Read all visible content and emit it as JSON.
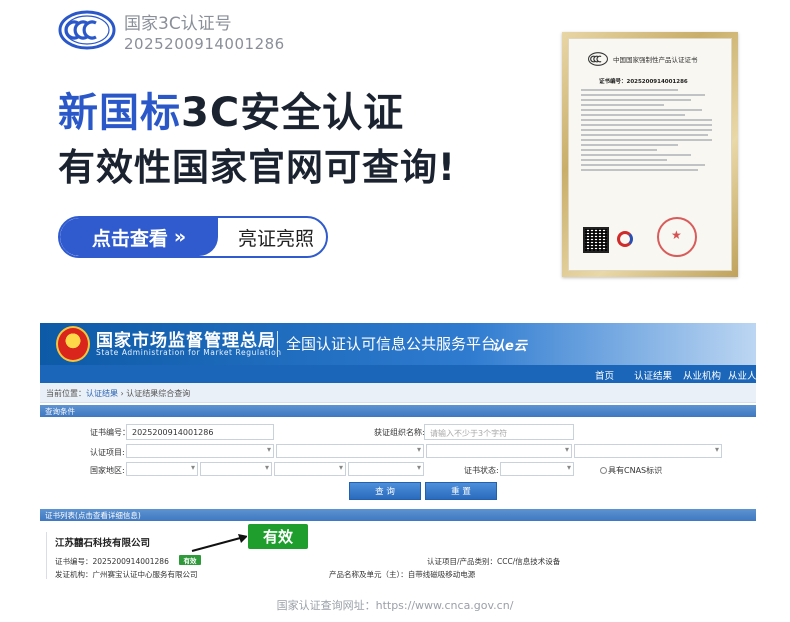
{
  "promo": {
    "ccc_title": "国家3C认证号",
    "ccc_number": "2025200914001286",
    "headline_blue": "新国标",
    "headline_dark": "3C安全认证",
    "headline_line2": "有效性国家官网可查询!",
    "cta_primary": "点击查看",
    "cta_primary_icon": "double-chevron-right-icon",
    "cta_secondary": "亮证亮照",
    "accent_color": "#2f5bcf"
  },
  "certificate": {
    "title": "中国国家强制性产品认证证书",
    "number": "证书编号：2025200914001286"
  },
  "portal": {
    "org_cn": "国家市场监督管理总局",
    "org_en": "State Administration for Market Regulation",
    "platform": "全国认证认可信息公共服务平台",
    "platform_logo": "认e云",
    "nav": [
      "首页",
      "认证结果",
      "从业机构",
      "从业人员"
    ],
    "breadcrumb_prefix": "当前位置：",
    "breadcrumb_link": "认证结果",
    "breadcrumb_sep": "›",
    "breadcrumb_current": "认证结果综合查询",
    "query_section": "查询条件",
    "form": {
      "cert_no_label": "证书编号：",
      "cert_no_value": "2025200914001286",
      "org_label": "获证组织名称:",
      "org_placeholder": "请输入不少于3个字符",
      "project_label": "认证项目:",
      "region_label": "国家地区:",
      "status_label": "证书状态:",
      "cnas_label": "具有CNAS标识",
      "query_button": "查 询",
      "reset_button": "重 置"
    },
    "result_section": "证书列表(点击查看详细信息)",
    "result": {
      "company": "江苏囍石科技有限公司",
      "cert_no_label": "证书编号：",
      "cert_no": "2025200914001286",
      "status": "有效",
      "category_label": "认证项目/产品类别：",
      "category": "CCC/信息技术设备",
      "issuer_label": "发证机构：",
      "issuer": "广州赛宝认证中心服务有限公司",
      "product_label": "产品名称及单元（主）：",
      "product": "自带线磁吸移动电源"
    },
    "big_badge": "有效",
    "header_color": "#0d5aa7",
    "valid_color": "#1f9e2e"
  },
  "footer": {
    "label": "国家认证查询网址：",
    "url": "https://www.cnca.gov.cn/"
  }
}
